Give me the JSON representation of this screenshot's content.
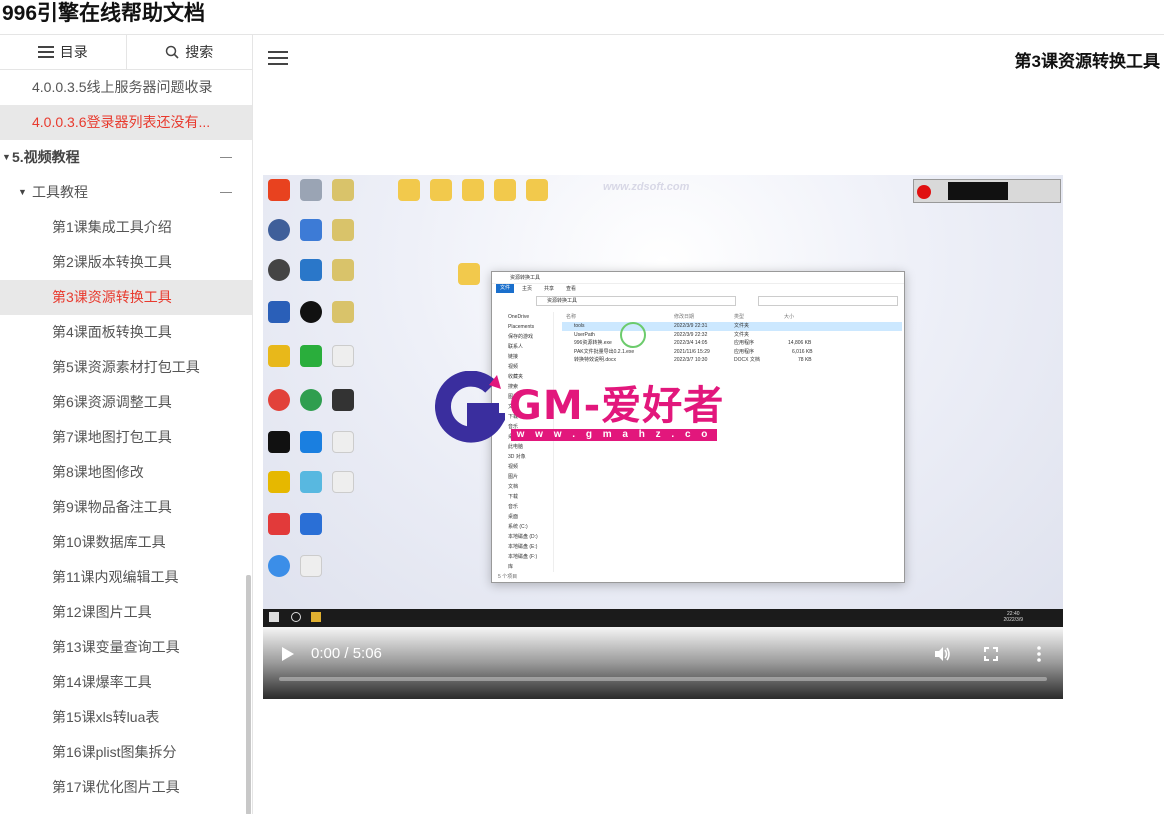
{
  "site": {
    "title": "996引擎在线帮助文档"
  },
  "sidebar": {
    "tabs": [
      {
        "label": "目录",
        "icon": "list-icon"
      },
      {
        "label": "搜索",
        "icon": "search-icon"
      }
    ],
    "items": [
      {
        "label": "4.0.0.3.5线上服务器问题收录",
        "level": 3,
        "active": false
      },
      {
        "label": "4.0.0.3.6登录器列表还没有...",
        "level": 3,
        "active": true
      },
      {
        "label": "5.视频教程",
        "level": 1,
        "active": false
      },
      {
        "label": "工具教程",
        "level": 2,
        "active": false
      },
      {
        "label": "第1课集成工具介绍",
        "active": false
      },
      {
        "label": "第2课版本转换工具",
        "active": false
      },
      {
        "label": "第3课资源转换工具",
        "active": true
      },
      {
        "label": "第4课面板转换工具",
        "active": false
      },
      {
        "label": "第5课资源素材打包工具",
        "active": false
      },
      {
        "label": "第6课资源调整工具",
        "active": false
      },
      {
        "label": "第7课地图打包工具",
        "active": false
      },
      {
        "label": "第8课地图修改",
        "active": false
      },
      {
        "label": "第9课物品备注工具",
        "active": false
      },
      {
        "label": "第10课数据库工具",
        "active": false
      },
      {
        "label": "第11课内观编辑工具",
        "active": false
      },
      {
        "label": "第12课图片工具",
        "active": false
      },
      {
        "label": "第13课变量查询工具",
        "active": false
      },
      {
        "label": "第14课爆率工具",
        "active": false
      },
      {
        "label": "第15课xls转lua表",
        "active": false
      },
      {
        "label": "第16课plist图集拆分",
        "active": false
      },
      {
        "label": "第17课优化图片工具",
        "active": false
      }
    ]
  },
  "main": {
    "title": "第3课资源转换工具"
  },
  "video": {
    "time": "0:00 / 5:06",
    "progress": 0,
    "frame": {
      "watermark": "www.zdsoft.com",
      "logo_text": "GM-爱好者",
      "logo_url": "w w w . g m a h z . c o m",
      "clock_time": "22:40",
      "clock_date": "2022/3/9",
      "explorer": {
        "title": "资源转换工具",
        "ribbon": [
          "文件",
          "主页",
          "共享",
          "查看"
        ],
        "address": "资源转换工具",
        "nav": [
          "OneDrive",
          "Placements",
          "保存的游戏",
          "联系人",
          "链接",
          "视频",
          "收藏夹",
          "搜索",
          "图片",
          "文档",
          "下载",
          "音乐",
          "桌面",
          "此电脑",
          "3D 对象",
          "视频",
          "图片",
          "文档",
          "下载",
          "音乐",
          "桌面",
          "系统 (C:)",
          "本地磁盘 (D:)",
          "本地磁盘 (E:)",
          "本地磁盘 (F:)",
          "库"
        ],
        "columns": [
          "名称",
          "修改日期",
          "类型",
          "大小"
        ],
        "files": [
          {
            "name": "tools",
            "date": "2022/3/9 22:31",
            "type": "文件夹",
            "size": ""
          },
          {
            "name": "UserPath",
            "date": "2022/3/9 22:32",
            "type": "文件夹",
            "size": ""
          },
          {
            "name": "996资源转换.exe",
            "date": "2022/3/4 14:05",
            "type": "应用程序",
            "size": "14,806 KB"
          },
          {
            "name": "PAK文件批量导出0.2.1.exe",
            "date": "2021/11/6 15:29",
            "type": "应用程序",
            "size": "6,016 KB"
          },
          {
            "name": "转换特效说明.docx",
            "date": "2022/3/7 10:30",
            "type": "DOCX 文档",
            "size": "78 KB"
          }
        ],
        "status": "5 个项目"
      }
    }
  }
}
